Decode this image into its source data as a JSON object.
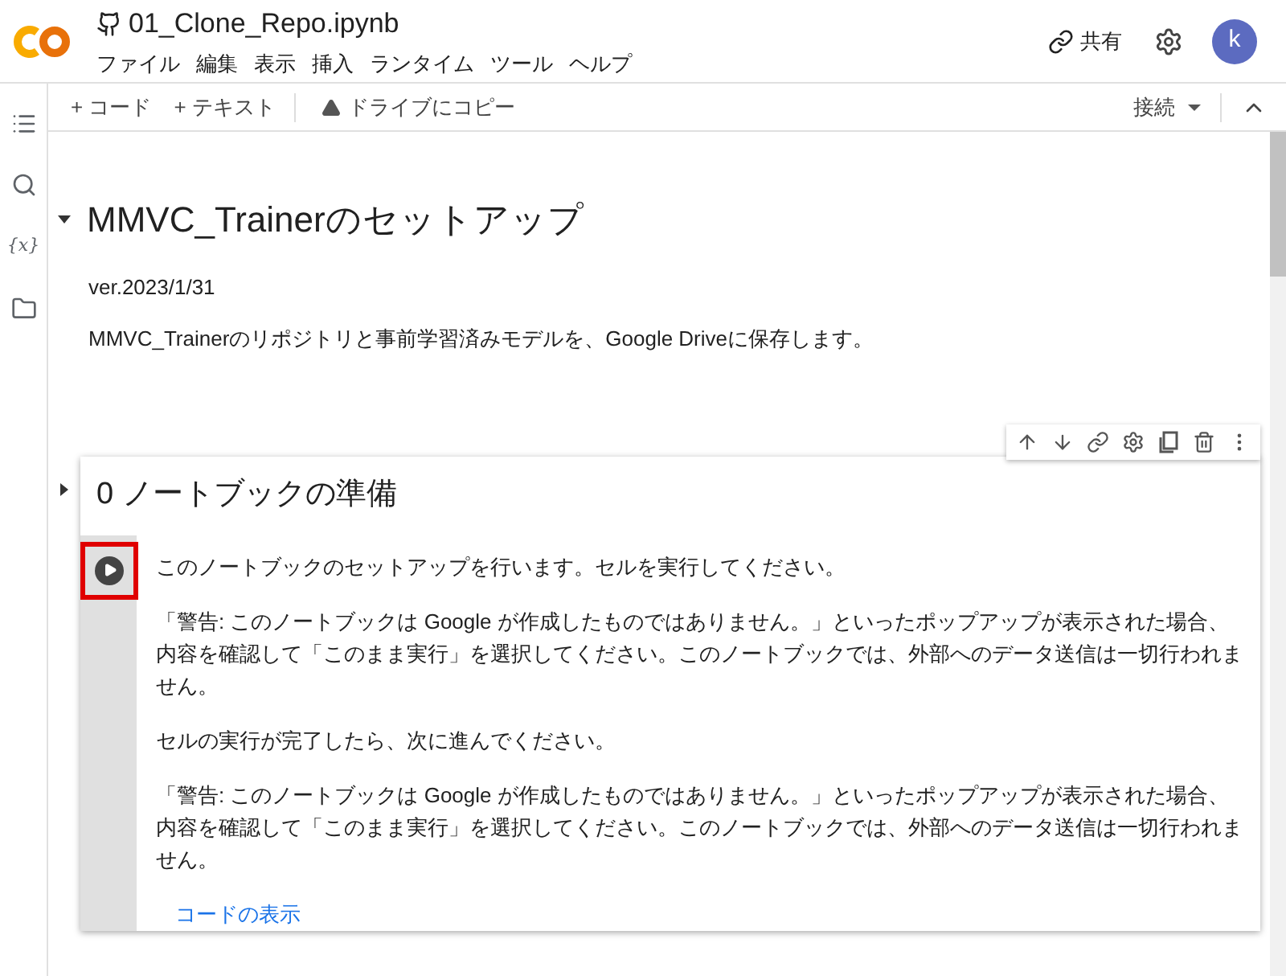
{
  "header": {
    "title": "01_Clone_Repo.ipynb",
    "menu": [
      "ファイル",
      "編集",
      "表示",
      "挿入",
      "ランタイム",
      "ツール",
      "ヘルプ"
    ],
    "share": "共有",
    "avatar": "k"
  },
  "toolbar": {
    "add_code": "+ コード",
    "add_text": "+ テキスト",
    "copy_drive": "ドライブにコピー",
    "connect": "接続"
  },
  "sidebar": {
    "items": [
      {
        "kind": "toc"
      },
      {
        "kind": "search"
      },
      {
        "kind": "variables",
        "label": "{x}"
      },
      {
        "kind": "files"
      }
    ]
  },
  "section": {
    "title": "MMVC_Trainerのセットアップ",
    "expanded": true,
    "paragraphs": [
      "ver.2023/1/31",
      "MMVC_Trainerのリポジトリと事前学習済みモデルを、Google Driveに保存します。"
    ]
  },
  "cell": {
    "title": "0 ノートブックの準備",
    "expanded": false,
    "selected": true,
    "paragraphs": [
      "このノートブックのセットアップを行います。セルを実行してください。",
      "「警告: このノートブックは Google が作成したものではありません。」といったポップアップが表示された場合、内容を確認して「このまま実行」を選択してください。このノートブックでは、外部へのデータ送信は一切行われません。",
      "セルの実行が完了したら、次に進んでください。",
      "「警告: このノートブックは Google が作成したものではありません。」といったポップアップが表示された場合、内容を確認して「このまま実行」を選択してください。このノートブックでは、外部へのデータ送信は一切行われません。"
    ],
    "show_code": "コードの表示",
    "run_highlighted": true
  }
}
